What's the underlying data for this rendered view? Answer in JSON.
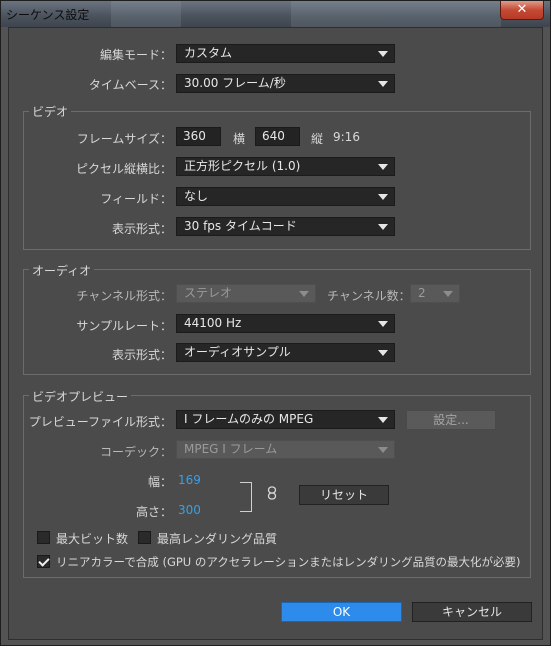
{
  "window": {
    "title": "シーケンス設定",
    "close_label": "✕"
  },
  "edit_mode": {
    "label": "編集モード：",
    "value": "カスタム"
  },
  "timebase": {
    "label": "タイムベース：",
    "value": "30.00 フレーム/秒"
  },
  "video": {
    "group_title": "ビデオ",
    "frame_size": {
      "label": "フレームサイズ：",
      "width": "360",
      "width_label": "横",
      "height": "640",
      "height_label": "縦",
      "aspect": "9:16"
    },
    "pixel_aspect": {
      "label": "ピクセル縦横比：",
      "value": "正方形ピクセル (1.0)"
    },
    "fields": {
      "label": "フィールド：",
      "value": "なし"
    },
    "display_format": {
      "label": "表示形式：",
      "value": "30 fps タイムコード"
    }
  },
  "audio": {
    "group_title": "オーディオ",
    "channel_format": {
      "label": "チャンネル形式：",
      "value": "ステレオ"
    },
    "channel_count": {
      "label": "チャンネル数：",
      "value": "2"
    },
    "sample_rate": {
      "label": "サンプルレート：",
      "value": "44100 Hz"
    },
    "display_format": {
      "label": "表示形式：",
      "value": "オーディオサンプル"
    }
  },
  "preview": {
    "group_title": "ビデオプレビュー",
    "file_format": {
      "label": "プレビューファイル形式：",
      "value": "I フレームのみの MPEG"
    },
    "settings_button": "設定...",
    "codec": {
      "label": "コーデック：",
      "value": "MPEG I フレーム"
    },
    "width": {
      "label": "幅：",
      "value": "169"
    },
    "height": {
      "label": "高さ：",
      "value": "300"
    },
    "link_icon": "chain-link-icon",
    "reset_button": "リセット",
    "max_bit_depth": {
      "label": "最大ビット数",
      "checked": false
    },
    "max_render_quality": {
      "label": "最高レンダリング品質",
      "checked": false
    },
    "linear_color": {
      "label": "リニアカラーで合成 (GPU のアクセラレーションまたはレンダリング品質の最大化が必要)",
      "checked": true
    }
  },
  "footer": {
    "ok": "OK",
    "cancel": "キャンセル"
  }
}
